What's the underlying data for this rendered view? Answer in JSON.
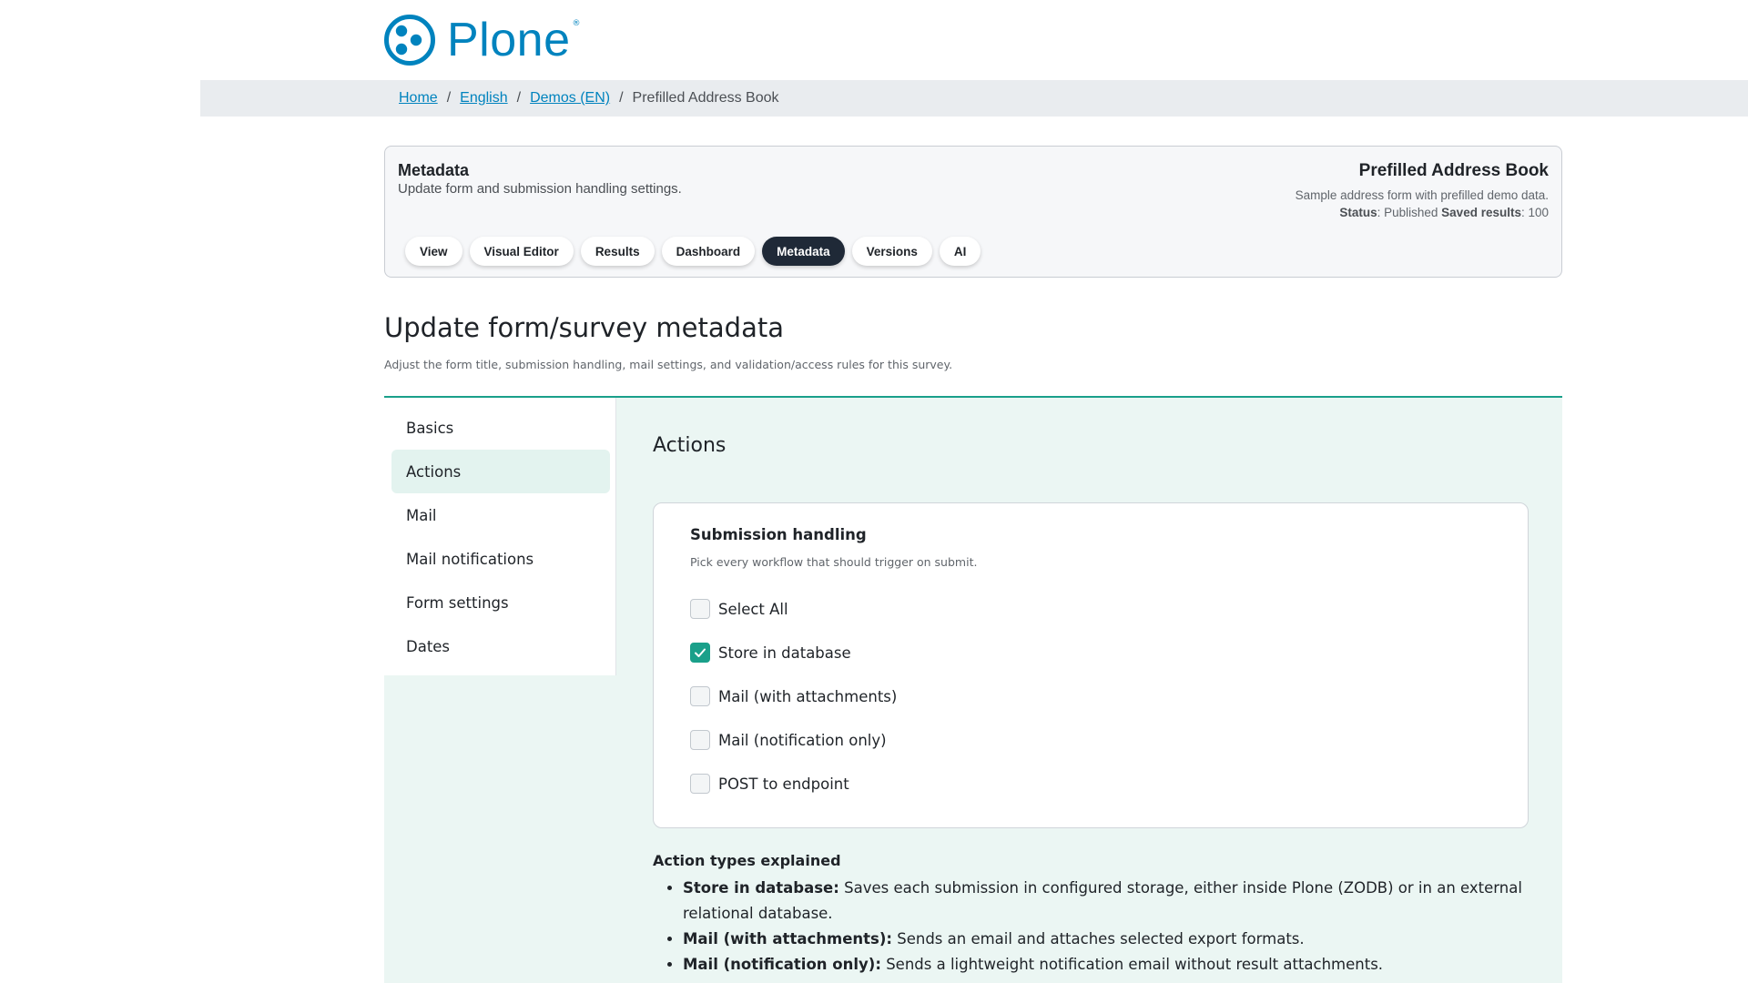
{
  "header": {
    "logo_text": "Plone",
    "logo_mark": "®"
  },
  "breadcrumb": {
    "links": [
      "Home",
      "English",
      "Demos (EN)"
    ],
    "current": "Prefilled Address Book",
    "separator": "/"
  },
  "card": {
    "title": "Metadata",
    "subtitle": "Update form and submission handling settings.",
    "form_title": "Prefilled Address Book",
    "form_description": "Sample address form with prefilled demo data.",
    "status_label": "Status",
    "status_value": ": Published ",
    "saved_label": "Saved results",
    "saved_value": ": 100",
    "tabs": [
      {
        "label": "View",
        "active": false
      },
      {
        "label": "Visual Editor",
        "active": false
      },
      {
        "label": "Results",
        "active": false
      },
      {
        "label": "Dashboard",
        "active": false
      },
      {
        "label": "Metadata",
        "active": true
      },
      {
        "label": "Versions",
        "active": false
      },
      {
        "label": "AI",
        "active": false
      }
    ]
  },
  "page": {
    "title": "Update form/survey metadata",
    "description": "Adjust the form title, submission handling, mail settings, and validation/access rules for this survey."
  },
  "sidenav": {
    "items": [
      {
        "label": "Basics",
        "active": false
      },
      {
        "label": "Actions",
        "active": true
      },
      {
        "label": "Mail",
        "active": false
      },
      {
        "label": "Mail notifications",
        "active": false
      },
      {
        "label": "Form settings",
        "active": false
      },
      {
        "label": "Dates",
        "active": false
      }
    ]
  },
  "actions": {
    "section_title": "Actions",
    "submission": {
      "title": "Submission handling",
      "help": "Pick every workflow that should trigger on submit.",
      "options": [
        {
          "label": "Select All",
          "checked": false
        },
        {
          "label": "Store in database",
          "checked": true
        },
        {
          "label": "Mail (with attachments)",
          "checked": false
        },
        {
          "label": "Mail (notification only)",
          "checked": false
        },
        {
          "label": "POST to endpoint",
          "checked": false
        }
      ]
    },
    "explained": {
      "title": "Action types explained",
      "items": [
        {
          "term": "Store in database:",
          "text": "Saves each submission in configured storage, either inside Plone (ZODB) or in an external relational database."
        },
        {
          "term": "Mail (with attachments):",
          "text": "Sends an email and attaches selected export formats."
        },
        {
          "term": "Mail (notification only):",
          "text": "Sends a lightweight notification email without result attachments."
        }
      ]
    }
  },
  "colors": {
    "brand": "#0083be",
    "accent": "#1aa08a",
    "active_tab": "#1f2937",
    "panel_bg": "#ebf6f3"
  },
  "icons": {
    "logo": "plone-logo-icon",
    "checkbox_checked": "checkmark-icon"
  }
}
